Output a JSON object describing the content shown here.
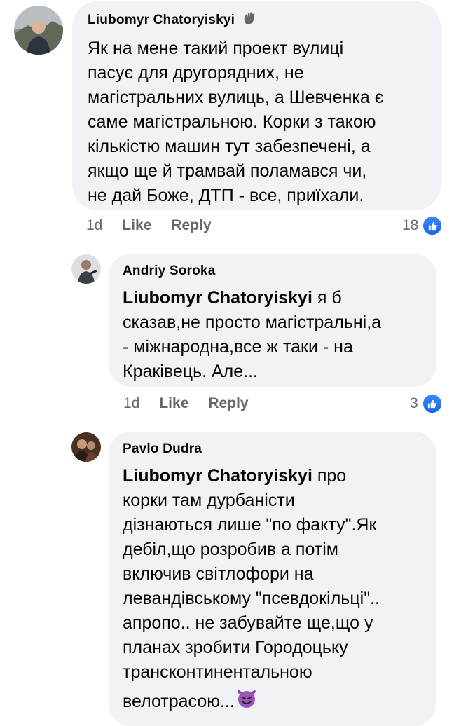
{
  "comments": [
    {
      "author": "Liubomyr Chatoryiskyi",
      "badge_icon": "wave-hand-icon",
      "lines": [
        "Як на мене такий проект вулиці",
        "пасує для другорядних, не",
        "магістральних вулиць, а Шевченка є",
        "саме магістральною. Корки з такою",
        "кількістю машин тут забезпечені, а",
        "якщо ще й трамвай поламався чи,",
        "не дай Боже, ДТП - все, приїхали."
      ],
      "time": "1d",
      "like_label": "Like",
      "reply_label": "Reply",
      "reaction_count": "18"
    },
    {
      "author": "Andriy Soroka",
      "mention": "Liubomyr Chatoryiskyi",
      "lines": [
        " я б",
        "сказав,не просто магістральні,а",
        "- міжнародна,все ж таки - на",
        "Краківець. Але..."
      ],
      "time": "1d",
      "like_label": "Like",
      "reply_label": "Reply",
      "reaction_count": "3"
    },
    {
      "author": "Pavlo Dudra",
      "mention": "Liubomyr Chatoryiskyi",
      "lines": [
        " про",
        "корки там дурбаністи",
        "дізнаються лише \"по факту\".Як",
        "дебіл,що розробив а потім",
        "включив світлофори на",
        "левандівському \"псевдокільці\"..",
        "апропо.. не забувайте ще,що у",
        "планах зробити Городоцьку",
        "трансконтинентальною",
        "велотрасою..."
      ],
      "emoji_icon": "smiling-devil-emoji"
    }
  ]
}
